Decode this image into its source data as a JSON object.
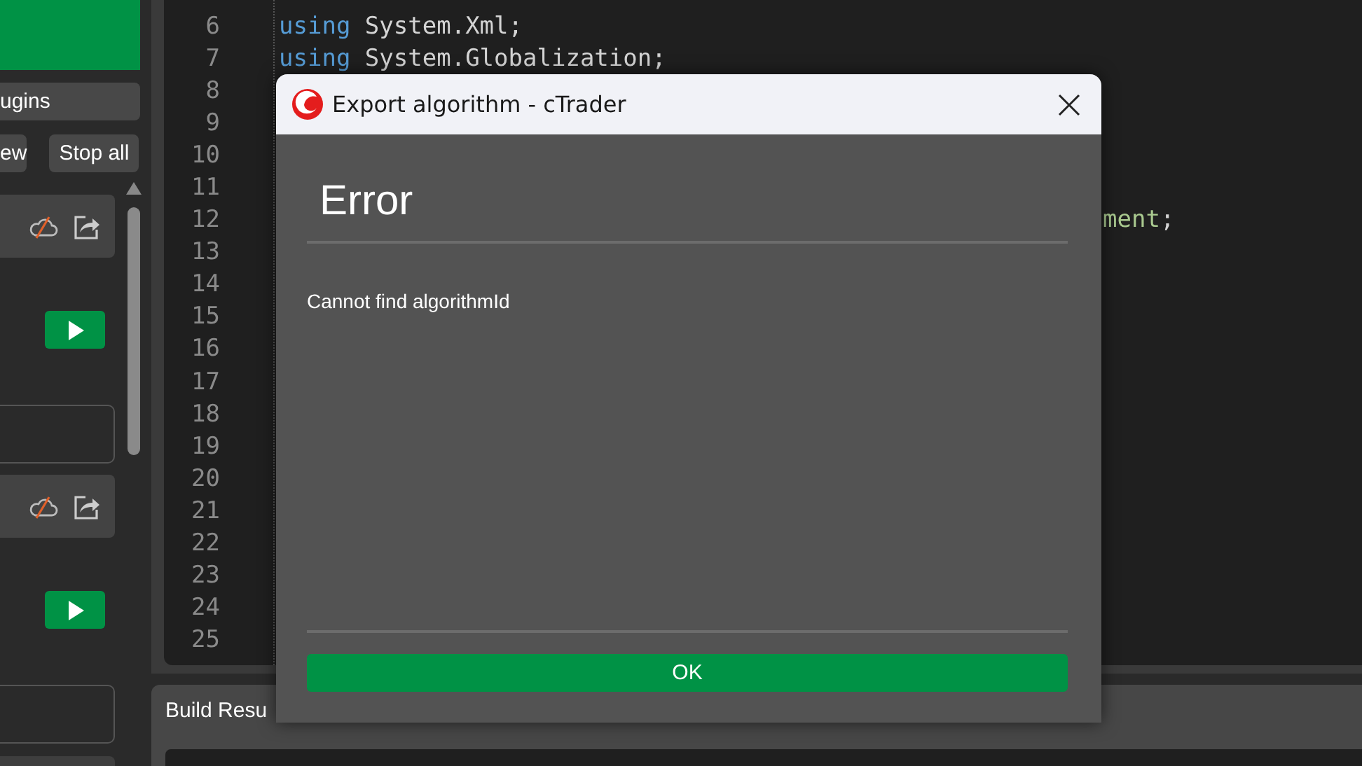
{
  "sidebar": {
    "buttons": [
      {
        "label": "ugins"
      }
    ],
    "actions": [
      {
        "label": "ew"
      },
      {
        "label": "Stop all"
      }
    ],
    "cards": [
      {
        "cloud_synced": false
      },
      {
        "cloud_synced": false
      }
    ]
  },
  "editor": {
    "lines": [
      {
        "number": "6",
        "code": [
          {
            "kind": "keyword",
            "text": "using"
          },
          {
            "kind": "plain",
            "text": " System.Xml;"
          }
        ]
      },
      {
        "number": "7",
        "code": [
          {
            "kind": "keyword",
            "text": "using"
          },
          {
            "kind": "plain",
            "text": " System.Globalization;"
          }
        ]
      },
      {
        "number": "8"
      },
      {
        "number": "9"
      },
      {
        "number": "10"
      },
      {
        "number": "11"
      },
      {
        "number": "12",
        "partly_covered": true,
        "code": [
          {
            "kind": "type",
            "text": "ment"
          },
          {
            "kind": "plain",
            "text": ";"
          }
        ]
      },
      {
        "number": "13"
      },
      {
        "number": "14"
      },
      {
        "number": "15"
      },
      {
        "number": "16"
      },
      {
        "number": "17"
      },
      {
        "number": "18"
      },
      {
        "number": "19"
      },
      {
        "number": "20"
      },
      {
        "number": "21"
      },
      {
        "number": "22"
      },
      {
        "number": "23"
      },
      {
        "number": "24"
      },
      {
        "number": "25"
      }
    ]
  },
  "build_panel": {
    "title": "Build Resu"
  },
  "dialog": {
    "title": "Export algorithm - cTrader",
    "heading": "Error",
    "message": "Cannot find algorithmId",
    "ok_button": "OK"
  }
}
